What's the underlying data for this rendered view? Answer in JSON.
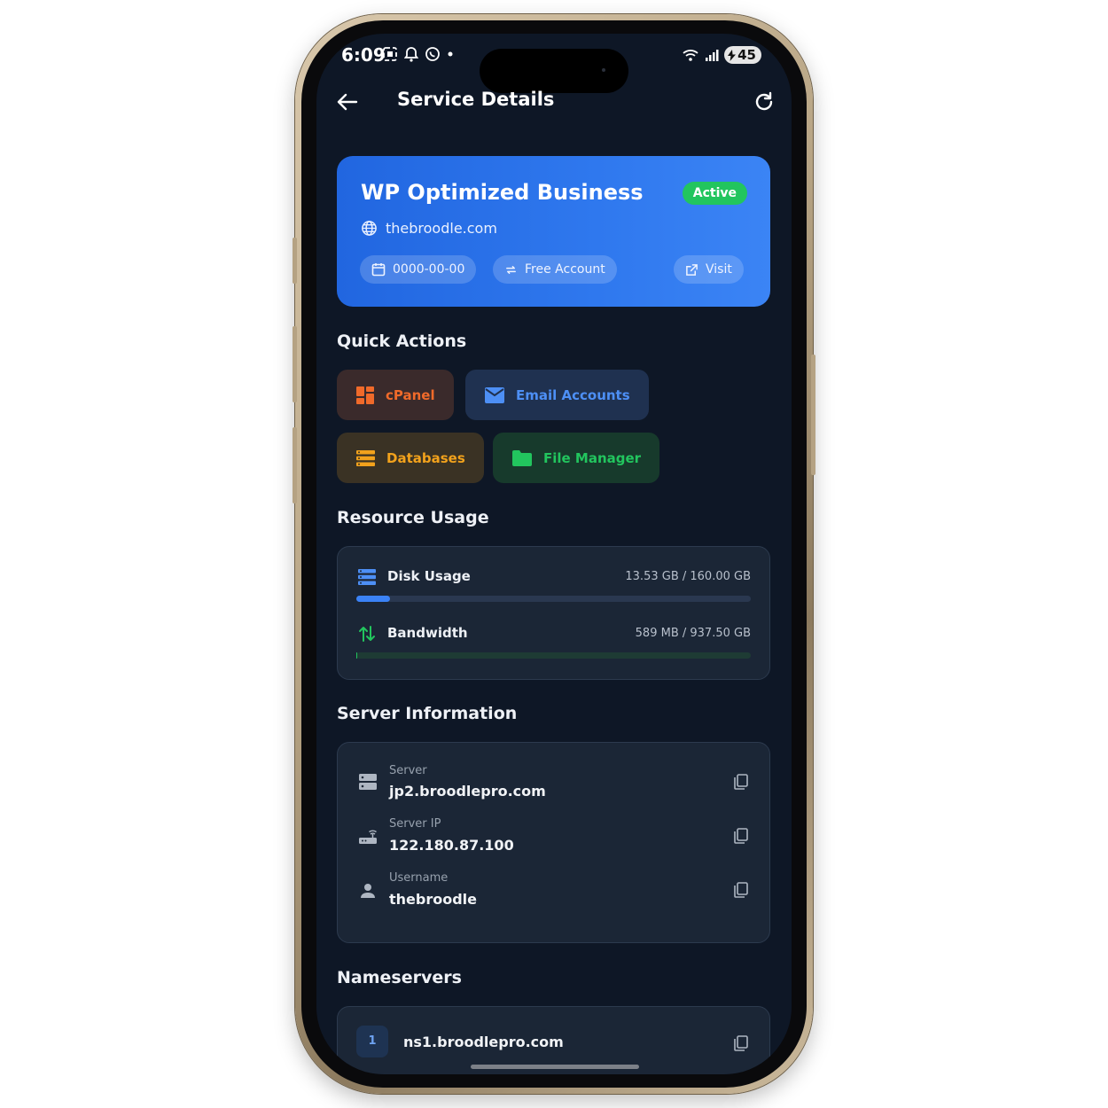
{
  "status_bar": {
    "time": "6:09",
    "battery": "45"
  },
  "header": {
    "title": "Service Details"
  },
  "service": {
    "name": "WP Optimized Business",
    "status": "Active",
    "domain": "thebroodle.com",
    "due_date": "0000-00-00",
    "billing_cycle": "Free Account",
    "visit_label": "Visit"
  },
  "quick_actions": {
    "title": "Quick Actions",
    "items": [
      {
        "label": "cPanel",
        "icon": "cpanel-icon",
        "color": "#f06a2a"
      },
      {
        "label": "Email Accounts",
        "icon": "mail-icon",
        "color": "#4d8ff5"
      },
      {
        "label": "Databases",
        "icon": "database-icon",
        "color": "#f2a21c"
      },
      {
        "label": "File Manager",
        "icon": "folder-icon",
        "color": "#22c55e"
      }
    ]
  },
  "resource_usage": {
    "title": "Resource Usage",
    "disk": {
      "label": "Disk Usage",
      "value": "13.53 GB / 160.00 GB",
      "fraction": 0.0846,
      "color": "#3b82f6"
    },
    "bandwidth": {
      "label": "Bandwidth",
      "value": "589 MB / 937.50 GB",
      "fraction": 0.0006,
      "color": "#22c55e"
    }
  },
  "server_info": {
    "title": "Server Information",
    "server": {
      "label": "Server",
      "value": "jp2.broodlepro.com"
    },
    "ip": {
      "label": "Server IP",
      "value": "122.180.87.100"
    },
    "username": {
      "label": "Username",
      "value": "thebroodle"
    }
  },
  "nameservers": {
    "title": "Nameservers",
    "items": [
      {
        "index": "1",
        "value": "ns1.broodlepro.com"
      }
    ]
  },
  "colors": {
    "background": "#0e1726",
    "card": "#1b2636",
    "accent_blue": "#2f78ee",
    "active_green": "#22c55e"
  }
}
